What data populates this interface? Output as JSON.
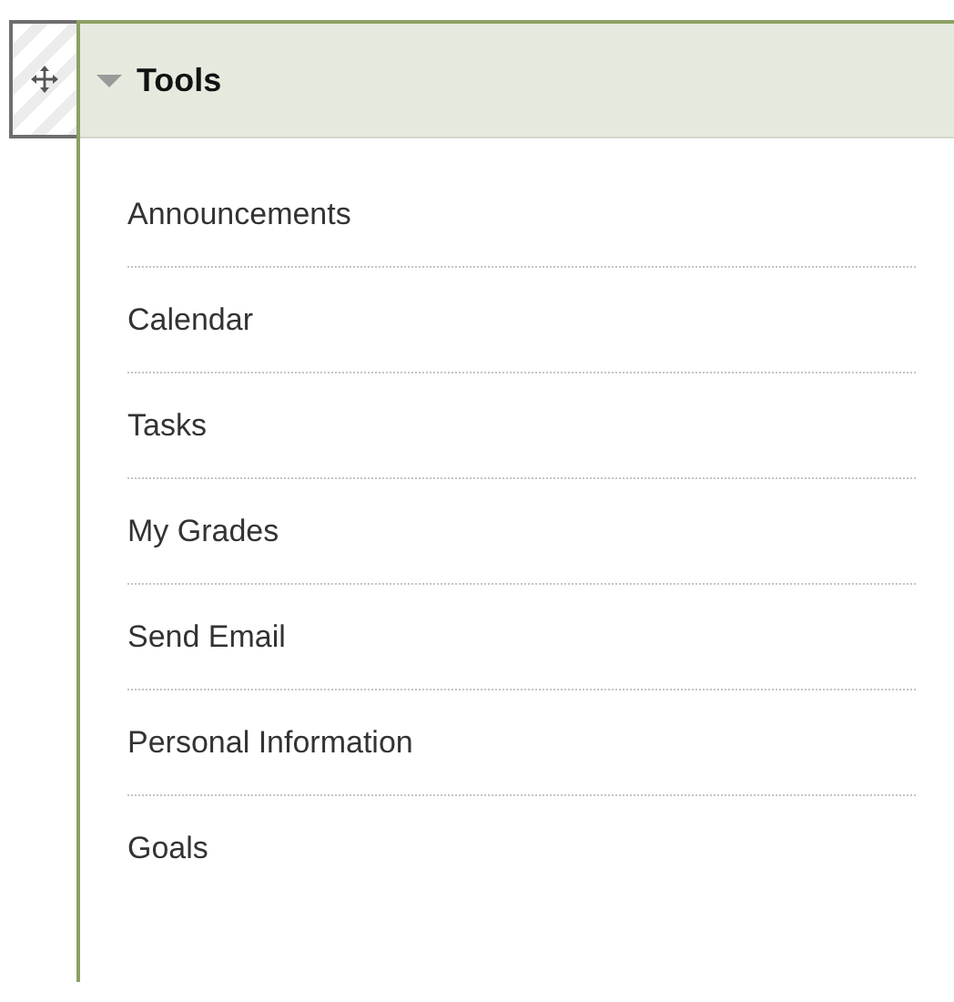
{
  "module": {
    "title": "Tools",
    "expanded": true,
    "items": [
      {
        "label": "Announcements"
      },
      {
        "label": "Calendar"
      },
      {
        "label": "Tasks"
      },
      {
        "label": "My Grades"
      },
      {
        "label": "Send Email"
      },
      {
        "label": "Personal Information"
      },
      {
        "label": "Goals"
      }
    ]
  }
}
